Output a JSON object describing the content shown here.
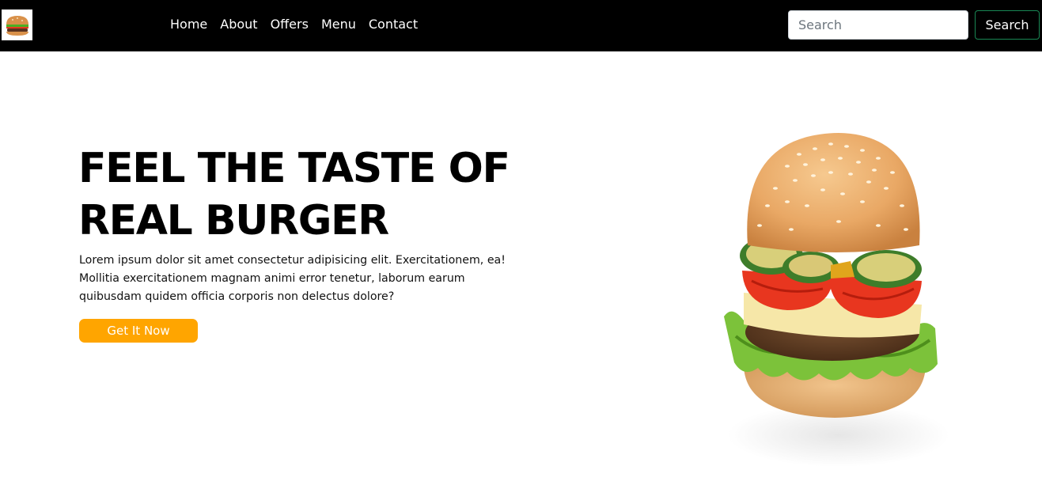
{
  "navbar": {
    "logo_icon": "burger-logo-icon",
    "links": [
      "Home",
      "About",
      "Offers",
      "Menu",
      "Contact"
    ],
    "search_placeholder": "Search",
    "search_button_label": "Search"
  },
  "hero": {
    "title": "FEEL THE TASTE OF REAL BURGER",
    "text": "Lorem ipsum dolor sit amet consectetur adipisicing elit. Exercitationem, ea! Mollitia exercitationem magnam animi error tenetur, laborum earum quibusdam quidem officia corporis non delectus dolore?",
    "cta_label": "Get It Now",
    "cta_color": "#ffa500",
    "image_icon": "burger-image"
  },
  "colors": {
    "navbar_bg": "#000000",
    "search_button_border": "#198754"
  }
}
